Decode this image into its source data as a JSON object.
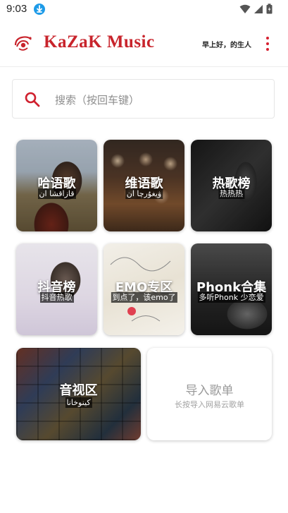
{
  "status_bar": {
    "time": "9:03"
  },
  "header": {
    "app_title": "KaZaK Music",
    "greeting": "早上好，的生人",
    "brand_color": "#c8242c"
  },
  "search": {
    "placeholder": "搜索（按回车键）"
  },
  "tiles": [
    {
      "title": "哈语歌",
      "subtitle": "قازاقشا ان"
    },
    {
      "title": "维语歌",
      "subtitle": "ۋيغۇرچا ان"
    },
    {
      "title": "热歌榜",
      "subtitle": "热热热"
    },
    {
      "title": "抖音榜",
      "subtitle": "抖音热歌"
    },
    {
      "title": "EMO专区",
      "subtitle": "到点了，该emo了"
    },
    {
      "title": "Phonk合集",
      "subtitle": "多听Phonk 少恋爱"
    },
    {
      "title": "音视区",
      "subtitle": "كينوخانا"
    }
  ],
  "import_card": {
    "title": "导入歌单",
    "subtitle": "长按导入网易云歌单"
  }
}
